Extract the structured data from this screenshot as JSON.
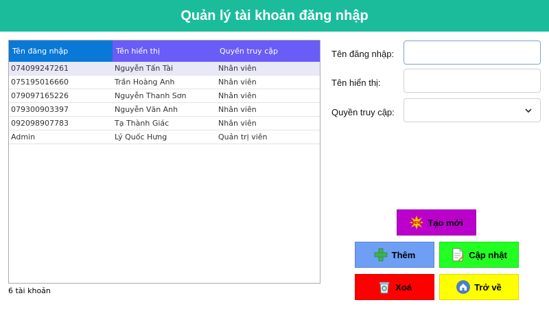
{
  "window": {
    "title": "Quản lý tài khoản đăng nhập"
  },
  "grid": {
    "headers": [
      "Tên đăng nhập",
      "Tên hiển thị",
      "Quyền truy cập"
    ],
    "rows": [
      [
        "074099247261",
        "Nguyễn Tấn Tài",
        "Nhân viên"
      ],
      [
        "075195016660",
        "Trần Hoàng Anh",
        "Nhân viên"
      ],
      [
        "079097165226",
        "Nguyễn Thanh Sơn",
        "Nhân viên"
      ],
      [
        "079300903397",
        "Nguyễn Văn Anh",
        "Nhân viên"
      ],
      [
        "092098907783",
        "Tạ Thành Giác",
        "Nhân viên"
      ],
      [
        "Admin",
        "Lý Quốc Hưng",
        "Quản trị viên"
      ]
    ],
    "selected_row": 0
  },
  "status": {
    "count": "6 tài khoản"
  },
  "form": {
    "username_label": "Tên đăng nhập:",
    "username_value": "",
    "displayname_label": "Tên hiển thị:",
    "displayname_value": "",
    "role_label": "Quyền truy cập:",
    "role_value": ""
  },
  "buttons": {
    "new_label": "Tạo mới",
    "new_icon": "new-starburst-icon",
    "add_label": "Thêm",
    "add_icon": "plus-icon",
    "update_label": "Cập nhật",
    "update_icon": "document-edit-icon",
    "delete_label": "Xoá",
    "delete_icon": "recycle-bin-icon",
    "back_label": "Trở về",
    "back_icon": "home-icon"
  },
  "colors": {
    "titlebar": "#1abc9c",
    "header_first": "#0a78d7",
    "header": "#6a5cf6",
    "new": "#bb00cc",
    "add": "#6f9ef5",
    "update": "#22ff22",
    "delete": "#ff0000",
    "back": "#ffff00"
  }
}
